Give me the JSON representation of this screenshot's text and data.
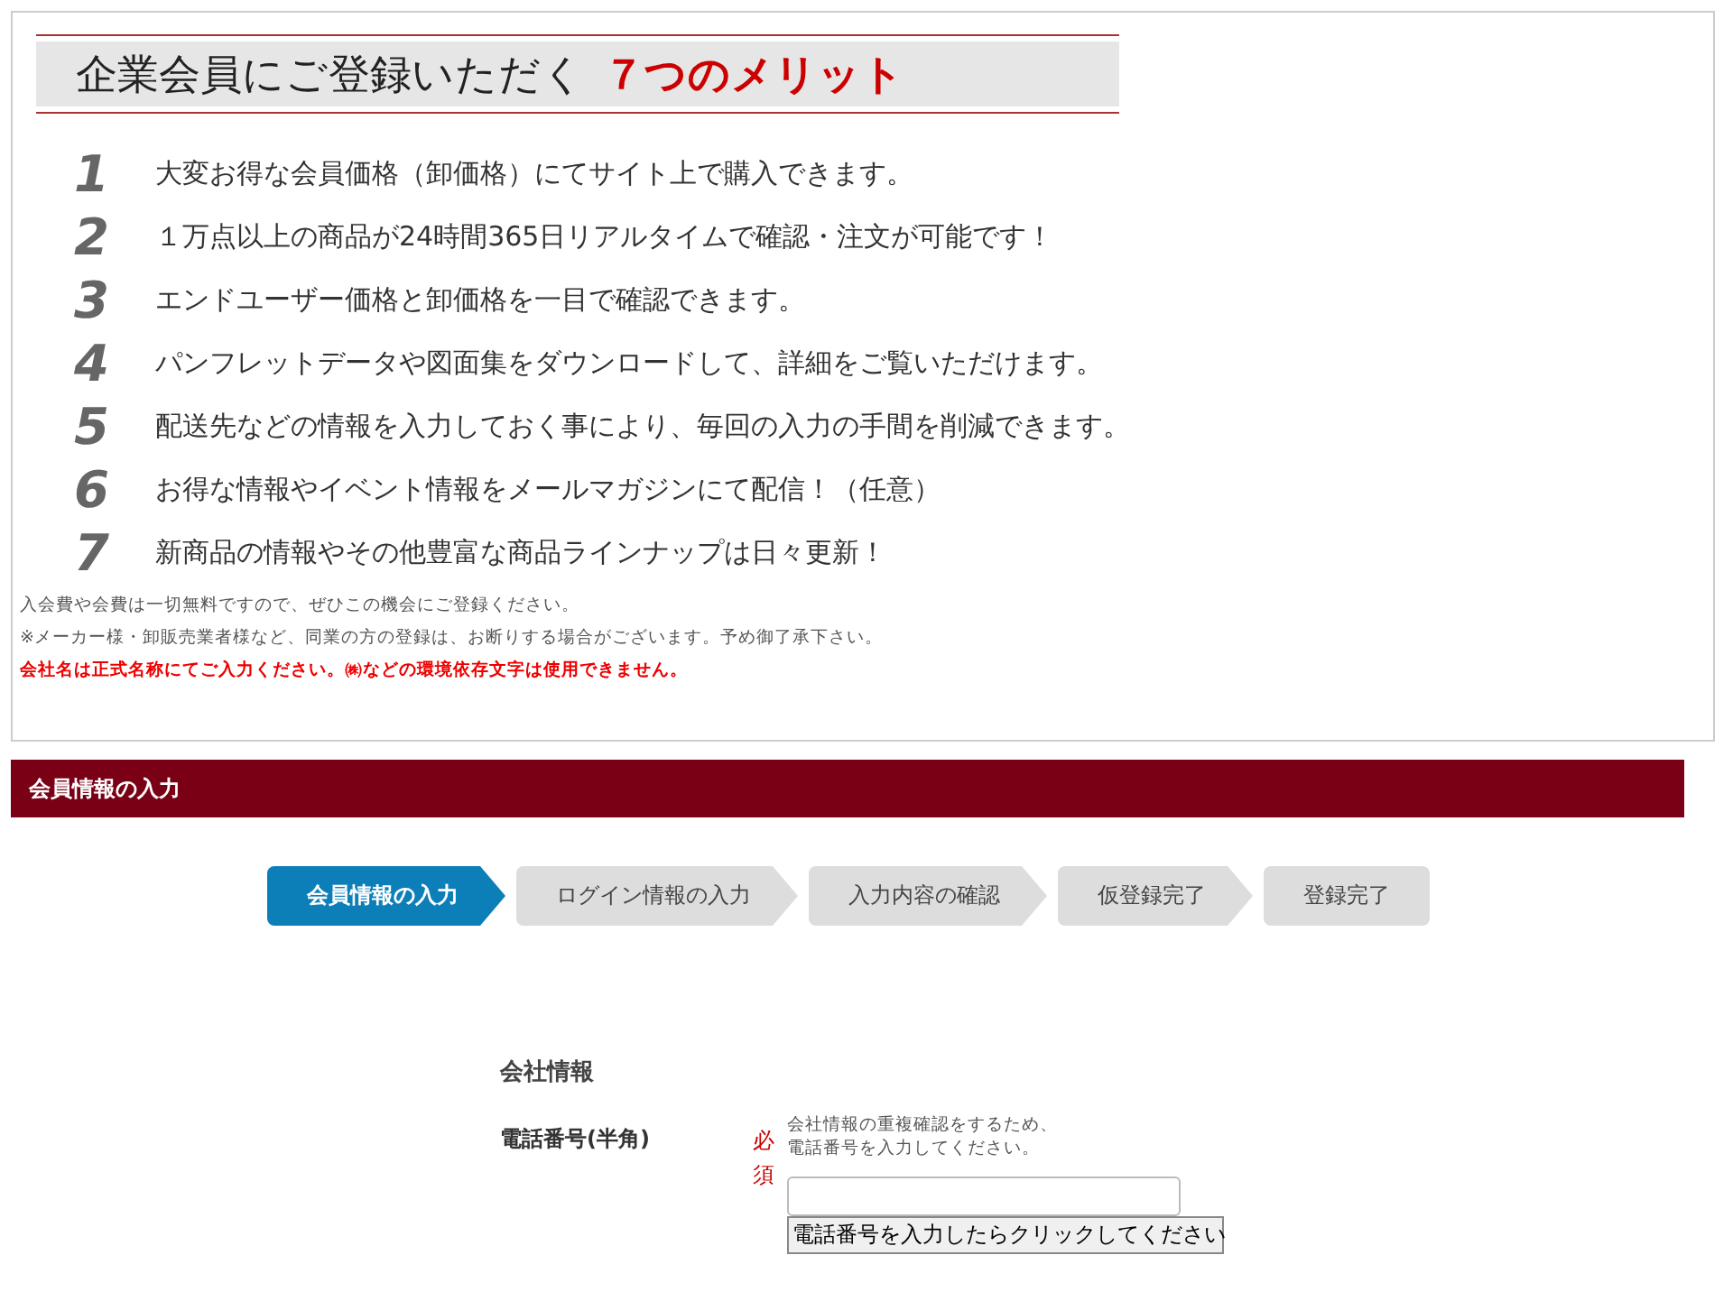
{
  "merits": {
    "title": "企業会員にご登録いただく",
    "title_highlight": "７つのメリット",
    "items": [
      {
        "number": "1",
        "text": "大変お得な会員価格（卸価格）にてサイト上で購入できます。"
      },
      {
        "number": "2",
        "text": "１万点以上の商品が24時間365日リアルタイムで確認・注文が可能です！"
      },
      {
        "number": "3",
        "text": "エンドユーザー価格と卸価格を一目で確認できます。"
      },
      {
        "number": "4",
        "text": "パンフレットデータや図面集をダウンロードして、詳細をご覧いただけます。"
      },
      {
        "number": "5",
        "text": "配送先などの情報を入力しておく事により、毎回の入力の手間を削減できます。"
      },
      {
        "number": "6",
        "text": "お得な情報やイベント情報をメールマガジンにて配信！（任意）"
      },
      {
        "number": "7",
        "text": "新商品の情報やその他豊富な商品ラインナップは日々更新！"
      }
    ],
    "notes": [
      {
        "text": "入会費や会費は一切無料ですので、ぜひこの機会にご登録ください。",
        "kind": "normal"
      },
      {
        "text": "※メーカー様・卸販売業者様など、同業の方の登録は、お断りする場合がございます。予め御了承下さい。",
        "kind": "normal"
      },
      {
        "text": "会社名は正式名称にてご入力ください。㈱などの環境依存文字は使用できません。",
        "kind": "warning"
      }
    ]
  },
  "section_bar": {
    "title": "会員情報の入力"
  },
  "steps": [
    {
      "label": "会員情報の入力",
      "selected": true
    },
    {
      "label": "ログイン情報の入力",
      "selected": false
    },
    {
      "label": "入力内容の確認",
      "selected": false
    },
    {
      "label": "仮登録完了",
      "selected": false
    },
    {
      "label": "登録完了",
      "selected": false
    }
  ],
  "form": {
    "heading": "会社情報",
    "fields": [
      {
        "label": "電話番号(半角)",
        "required": true,
        "required_label": "必須",
        "help": [
          "会社情報の重複確認をするため、",
          "電話番号を入力してください。"
        ],
        "button": "電話番号を入力したらクリックしてください"
      }
    ]
  }
}
